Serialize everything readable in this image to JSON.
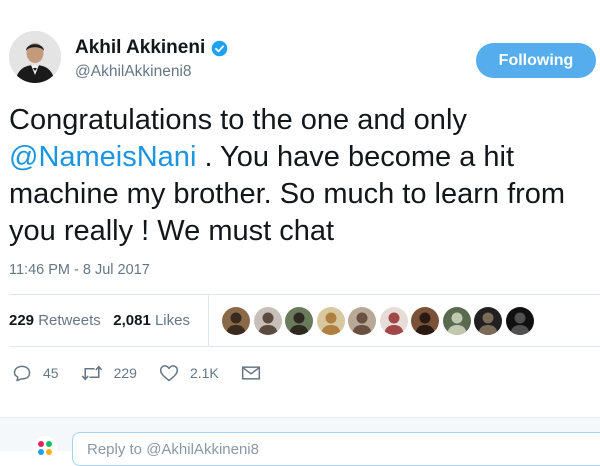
{
  "author": {
    "name": "Akhil Akkineni",
    "handle": "@AkhilAkkineni8",
    "verified": true
  },
  "follow_button": {
    "label": "Following",
    "color": "#55adee"
  },
  "tweet": {
    "lines": [
      {
        "text": "Congratulations to the one and only"
      },
      {
        "mention": "@NameisNani",
        "text": " . You have become a hit"
      },
      {
        "text": "machine my brother. So much to learn from"
      },
      {
        "text": "you really ! We must chat"
      }
    ],
    "timestamp": "11:46 PM - 8 Jul 2017"
  },
  "stats": {
    "retweets_count": "229",
    "retweets_label": "Retweets",
    "likes_count": "2,081",
    "likes_label": "Likes"
  },
  "likers": [
    {
      "bg": "#8b6a4a",
      "fg": "#3a2a1e"
    },
    {
      "bg": "#c8c0b8",
      "fg": "#5a4a40"
    },
    {
      "bg": "#6a7a5a",
      "fg": "#2e2a22"
    },
    {
      "bg": "#d8c8a0",
      "fg": "#b08040"
    },
    {
      "bg": "#b8a898",
      "fg": "#6a5040"
    },
    {
      "bg": "#e8dcd8",
      "fg": "#a04848"
    },
    {
      "bg": "#7a5238",
      "fg": "#2a1a14"
    },
    {
      "bg": "#5a6a50",
      "fg": "#c0c8b0"
    },
    {
      "bg": "#202020",
      "fg": "#7a6a58"
    },
    {
      "bg": "#101010",
      "fg": "#505050"
    }
  ],
  "actions": {
    "reply_count": "45",
    "retweet_count": "229",
    "like_count": "2.1K"
  },
  "reply": {
    "placeholder": "Reply to @AkhilAkkineni8"
  },
  "colors": {
    "accent": "#1b95e0",
    "text": "#14171a",
    "secondary": "#657786",
    "divider": "#e1e8ed"
  }
}
